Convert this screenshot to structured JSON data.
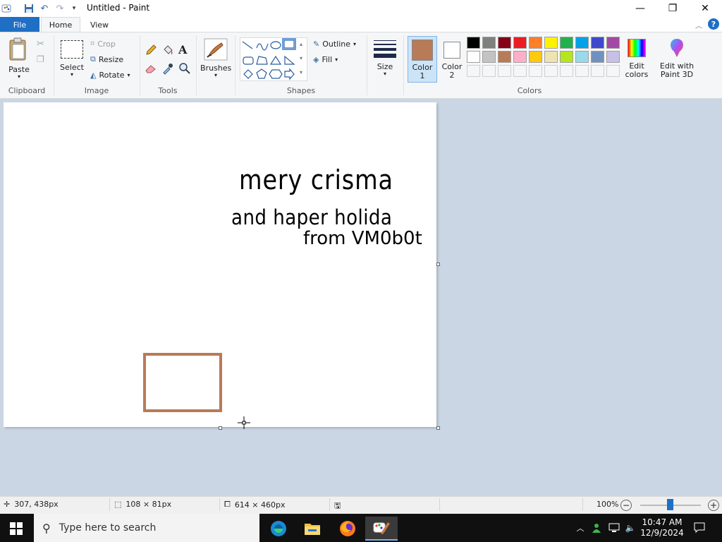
{
  "window": {
    "title": "Untitled - Paint"
  },
  "tabs": {
    "file": "File",
    "home": "Home",
    "view": "View"
  },
  "ribbon": {
    "clipboard": {
      "paste": "Paste",
      "group": "Clipboard"
    },
    "image": {
      "select": "Select",
      "crop": "Crop",
      "resize": "Resize",
      "rotate": "Rotate",
      "group": "Image"
    },
    "tools": {
      "group": "Tools"
    },
    "brushes": {
      "label": "Brushes"
    },
    "shapes": {
      "outline": "Outline",
      "fill": "Fill",
      "group": "Shapes"
    },
    "size": {
      "label": "Size"
    },
    "colors": {
      "color1_label": "Color",
      "color1_num": "1",
      "color2_label": "Color",
      "color2_num": "2",
      "edit_colors_1": "Edit",
      "edit_colors_2": "colors",
      "paint3d_1": "Edit with",
      "paint3d_2": "Paint 3D",
      "group": "Colors",
      "color1_value": "#b97a57",
      "color2_value": "#ffffff",
      "palette_row1": [
        "#000000",
        "#7f7f7f",
        "#880015",
        "#ed1c24",
        "#ff7f27",
        "#fff200",
        "#22b14c",
        "#00a2e8",
        "#3f48cc",
        "#a349a4"
      ],
      "palette_row2": [
        "#ffffff",
        "#c3c3c3",
        "#b97a57",
        "#ffaec9",
        "#ffc90e",
        "#efe4b0",
        "#b5e61d",
        "#99d9ea",
        "#7092be",
        "#c8bfe7"
      ]
    }
  },
  "canvas": {
    "line1": "mery  crisma",
    "line2": "and haper holida",
    "line3": "from VM0b0t",
    "rect_color": "#b97a57"
  },
  "status": {
    "cursor_pos": "307, 438px",
    "selection_size": "108 × 81px",
    "canvas_size": "614 × 460px",
    "zoom": "100%"
  },
  "taskbar": {
    "search_placeholder": "Type here to search",
    "time": "10:47 AM",
    "date": "12/9/2024"
  }
}
